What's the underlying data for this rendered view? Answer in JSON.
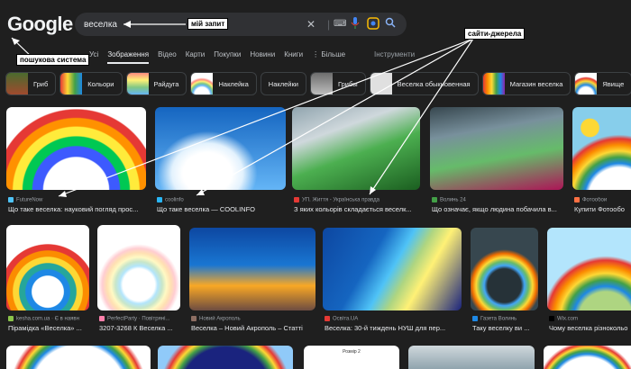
{
  "logo": "Google",
  "search": {
    "query": "веселка"
  },
  "annotations": {
    "query_label": "мій запит",
    "engine_label": "пошукова система",
    "sources_label": "сайти-джерела"
  },
  "tabs": [
    "Усі",
    "Зображення",
    "Відео",
    "Карти",
    "Покупки",
    "Новини",
    "Книги",
    "⋮ Більше"
  ],
  "tools": "Інструменти",
  "chips": [
    "Гриб",
    "Кольори",
    "Райдуга",
    "Наклейка",
    "Наклейки",
    "Грибы",
    "Веселка обыкновенная",
    "Магазин веселка",
    "Явище"
  ],
  "row1": [
    {
      "source": "FutureNow",
      "caption": "Що таке веселка: науковий погляд прос..."
    },
    {
      "source": "coolinfo",
      "caption": "Що таке веселка — COOLINFO"
    },
    {
      "source": "УП. Життя - Українська правда",
      "caption": "З яких кольорів складається веселк..."
    },
    {
      "source": "Волинь 24",
      "caption": "Що означає, якщо людина побачила в..."
    },
    {
      "source": "Фотообои",
      "caption": "Купити Фотообо"
    }
  ],
  "row2": [
    {
      "source": "kesha.com.ua · Є в наявн",
      "caption": "Пірамідка «Веселка» ..."
    },
    {
      "source": "PerfectParty · Повітряні...",
      "caption": "3207-3268 К Веселка ..."
    },
    {
      "source": "Новий Акрополь",
      "caption": "Веселка – Новий Акрополь – Статті"
    },
    {
      "source": "Освіта.UA",
      "caption": "Веселка: 30-й тиждень НУШ для пер..."
    },
    {
      "source": "Газета Волинь",
      "caption": "Таку веселку ви ..."
    },
    {
      "source": "Wix.com",
      "caption": "Чому веселка різнокольо"
    }
  ],
  "row3_text": "Розмір 2",
  "colors": {
    "bg": "#1f1f1f",
    "annotation": "#ffffff"
  }
}
